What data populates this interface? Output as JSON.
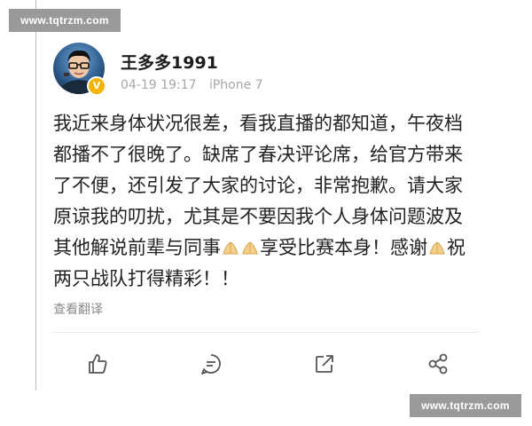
{
  "watermarks": {
    "top": "www.tqtrzm.com",
    "bottom": "www.tqtrzm.com"
  },
  "post": {
    "username": "王多多1991",
    "timestamp": "04-19 19:17",
    "device": "iPhone 7",
    "verified": true,
    "content_parts": [
      "我近来身体状况很差，看我直播的都知道，午夜档都播不了很晚了。缺席了春决评论席，给官方带来了不便，还引发了大家的讨论，非常抱歉。请大家原谅我的叨扰，尤其是不要因我个人身体问题波及其他解说前辈与同事",
      "享受比赛本身！感谢",
      "祝两只战队打得精彩！！"
    ],
    "translate_label": "查看翻译"
  },
  "actions": [
    {
      "icon": "like-icon"
    },
    {
      "icon": "comment-icon"
    },
    {
      "icon": "repost-icon"
    },
    {
      "icon": "share-icon"
    }
  ],
  "colors": {
    "verified": "#f4b400",
    "meta": "#a7a7a7",
    "watermark_bg": "#9a9a9a"
  }
}
